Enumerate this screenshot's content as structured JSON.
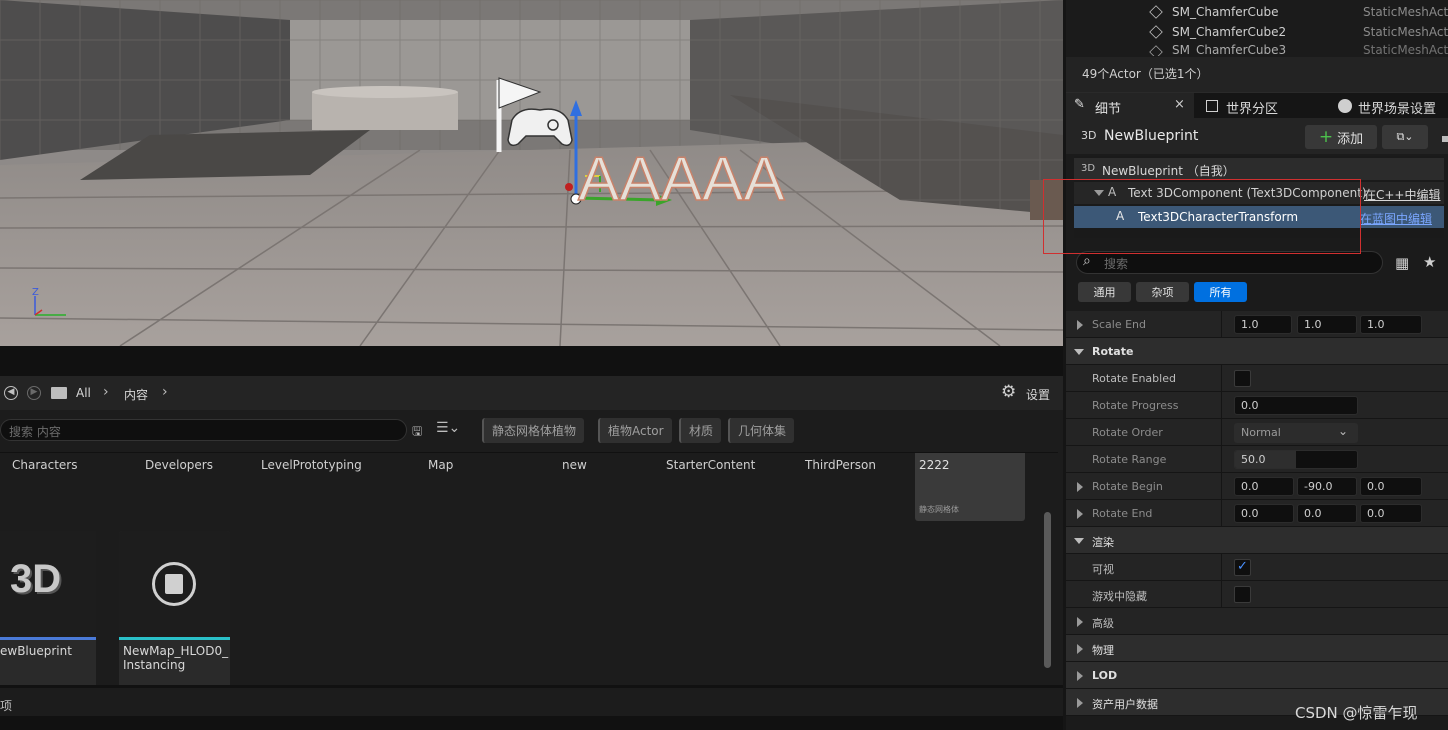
{
  "viewport": {
    "sign_text": "AAAAA",
    "axis_z": "Z"
  },
  "outliner": {
    "rows": [
      {
        "name": "SM_ChamferCube",
        "type": "StaticMeshAct"
      },
      {
        "name": "SM_ChamferCube2",
        "type": "StaticMeshAct"
      },
      {
        "name": "SM_ChamferCube3",
        "type": "StaticMeshAct"
      }
    ],
    "status": "49个Actor（已选1个）"
  },
  "tabs": [
    {
      "label": "细节",
      "close": "×"
    },
    {
      "label": "世界分区"
    },
    {
      "label": "世界场景设置"
    }
  ],
  "details": {
    "actor_badge": "3D",
    "actor_name": "NewBlueprint",
    "add_label": "添加",
    "tree": {
      "root": "NewBlueprint （自我）",
      "component": "Text 3DComponent (Text3DComponent)",
      "component_link": "在C++中编辑",
      "child": "Text3DCharacterTransform",
      "child_link": "在蓝图中编辑"
    },
    "search_placeholder": "搜索",
    "filters": [
      "通用",
      "杂项",
      "所有"
    ],
    "properties": {
      "scale_end": {
        "label": "Scale End",
        "values": [
          "1.0",
          "1.0",
          "1.0"
        ]
      },
      "rotate_cat": "Rotate",
      "rotate_enabled": "Rotate Enabled",
      "rotate_progress": {
        "label": "Rotate Progress",
        "value": "0.0"
      },
      "rotate_order": {
        "label": "Rotate Order",
        "value": "Normal"
      },
      "rotate_range": {
        "label": "Rotate Range",
        "value": "50.0"
      },
      "rotate_begin": {
        "label": "Rotate Begin",
        "values": [
          "0.0",
          "-90.0",
          "0.0"
        ]
      },
      "rotate_end": {
        "label": "Rotate End",
        "values": [
          "0.0",
          "0.0",
          "0.0"
        ]
      },
      "render_cat": "渲染",
      "visible": "可视",
      "hidden_in_game": "游戏中隐藏",
      "advanced": "高级",
      "physics": "物理",
      "lod": "LOD",
      "asset_user_data": "资产用户数据"
    }
  },
  "content_browser": {
    "path": [
      "All",
      "内容"
    ],
    "settings_label": "设置",
    "search_placeholder": "搜索 内容",
    "filter_chips": [
      "静态网格体植物",
      "植物Actor",
      "材质",
      "几何体集"
    ],
    "folders": [
      "Characters",
      "Developers",
      "LevelPrototyping",
      "Map",
      "new",
      "StarterContent",
      "ThirdPerson"
    ],
    "asset_2222": {
      "name": "2222",
      "type": "静态网格体"
    },
    "assets": [
      {
        "name": "ewBlueprint",
        "thumb": "3D"
      },
      {
        "name": "NewMap_HLOD0_\nInstancing"
      }
    ],
    "bottom_label": "项"
  },
  "watermark": "CSDN @惊雷乍现",
  "colors": {
    "accent": "#0070e0",
    "link": "#7aa6ff",
    "highlight_box": "#d03030"
  }
}
